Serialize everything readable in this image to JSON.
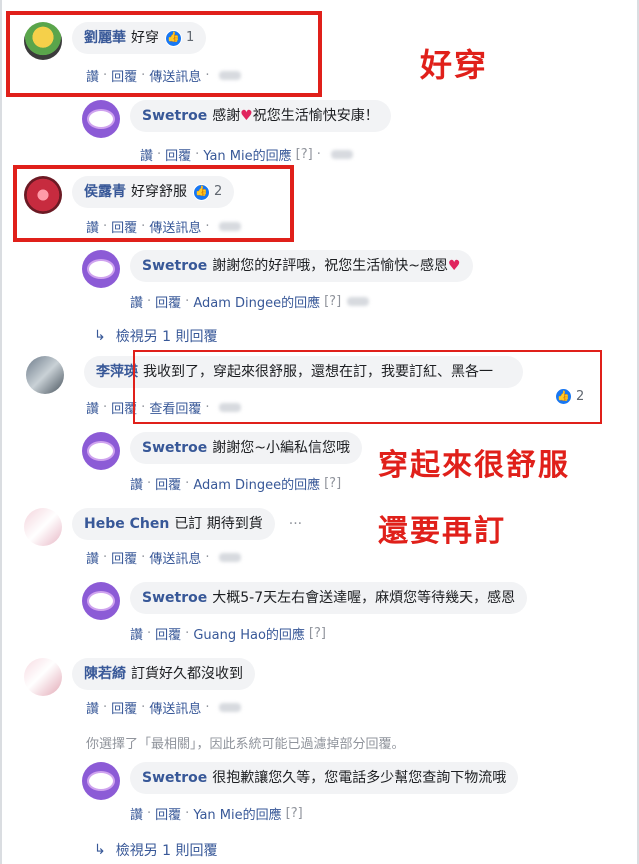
{
  "comments": [
    {
      "author": "劉麗華",
      "text": "好穿",
      "reactions": "1",
      "actions": [
        "讚",
        "回覆",
        "傳送訊息"
      ]
    },
    {
      "author": "Swetroe",
      "text": "感謝",
      "heart": "♥",
      "text2": "祝您生活愉快安康！",
      "actions": [
        "讚",
        "回覆",
        "Yan Mie的回應",
        "[?]"
      ]
    },
    {
      "author": "侯露青",
      "text": "好穿舒服",
      "reactions": "2",
      "actions": [
        "讚",
        "回覆",
        "傳送訊息"
      ]
    },
    {
      "author": "Swetroe",
      "text": "謝謝您的好評哦，祝您生活愉快~感恩",
      "heart": "♥",
      "actions": [
        "讚",
        "回覆",
        "Adam Dingee的回應",
        "[?]"
      ]
    },
    {
      "view_more": "檢視另 1 則回覆"
    },
    {
      "author": "李萍瑛",
      "text": "我收到了，穿起來很舒服，還想在訂，我要訂紅、黑各一",
      "reactions": "2",
      "actions": [
        "讚",
        "回覆",
        "查看回覆"
      ]
    },
    {
      "author": "Swetroe",
      "text": "謝謝您~小編私信您哦",
      "actions": [
        "讚",
        "回覆",
        "Adam Dingee的回應",
        "[?]"
      ]
    },
    {
      "author": "Hebe Chen",
      "text": "已訂 期待到貨",
      "more": "···",
      "actions": [
        "讚",
        "回覆",
        "傳送訊息"
      ]
    },
    {
      "author": "Swetroe",
      "text": "大概5-7天左右會送達喔，麻煩您等待幾天，感恩",
      "actions": [
        "讚",
        "回覆",
        "Guang Hao的回應",
        "[?]"
      ]
    },
    {
      "author": "陳若綺",
      "text": "訂貨好久都沒收到",
      "actions": [
        "讚",
        "回覆",
        "傳送訊息"
      ]
    },
    {
      "notice": "你選擇了「最相關」，因此系統可能已過濾掉部分回覆。"
    },
    {
      "author": "Swetroe",
      "text": "很抱歉讓您久等，您電話多少幫您查詢下物流哦",
      "actions": [
        "讚",
        "回覆",
        "Yan Mie的回應",
        "[?]"
      ]
    },
    {
      "view_more": "檢視另 1 則回覆"
    }
  ],
  "annotations": {
    "a1": "好穿",
    "a2": "穿起來很舒服",
    "a3": "還要再訂"
  },
  "colors": {
    "red": "#e0201a",
    "link": "#385898",
    "bubble": "#f2f3f5"
  }
}
